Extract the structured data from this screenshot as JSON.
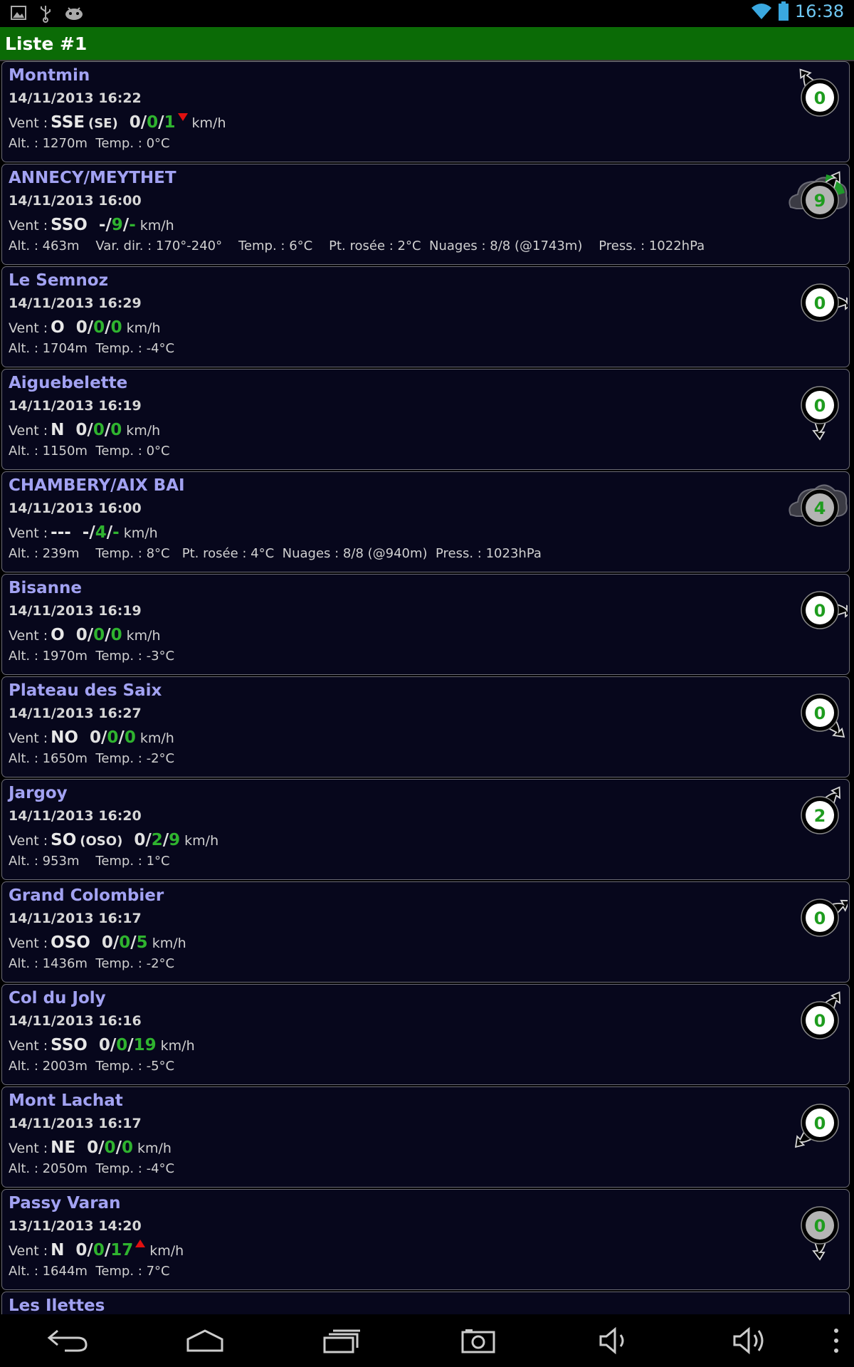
{
  "status_bar": {
    "time": "16:38",
    "left_icons": [
      "gallery-icon",
      "usb-icon",
      "android-debug-icon"
    ],
    "right_icons": [
      "wifi-icon",
      "battery-icon"
    ]
  },
  "title_bar": {
    "title": "Liste #1"
  },
  "colors": {
    "title_bar_bg": "#0b6b06",
    "station_name": "#a2a2f2",
    "wind_value_green": "#2fb32f",
    "trend_red": "#e01010",
    "card_bg": "#07071c"
  },
  "stations": [
    {
      "name": "Montmin",
      "date": "14/11/2013 16:22",
      "wind_label": "Vent :",
      "dir": "SSE",
      "dir2": "(SE)",
      "s1": "0",
      "s2": "0",
      "s3": "1",
      "trend": "down",
      "unit": "km/h",
      "details": "Alt. : 1270m  Temp. : 0°C",
      "badge": "0",
      "icon_type": "arrow",
      "arrow": "top-left",
      "ring": "white"
    },
    {
      "name": "ANNECY/MEYTHET",
      "date": "14/11/2013 16:00",
      "wind_label": "Vent :",
      "dir": "SSO",
      "dir2": "",
      "s1": "-",
      "s2": "9",
      "s3": "-",
      "trend": "",
      "unit": "km/h",
      "details": "Alt. : 463m    Var. dir. : 170°-240°    Temp. : 6°C    Pt. rosée : 2°C  Nuages : 8/8 (@1743m)    Press. : 1022hPa",
      "badge": "9",
      "icon_type": "cloud-arrow",
      "arrow": "top-right",
      "ring": "gray"
    },
    {
      "name": "Le Semnoz",
      "date": "14/11/2013 16:29",
      "wind_label": "Vent :",
      "dir": "O",
      "dir2": "",
      "s1": "0",
      "s2": "0",
      "s3": "0",
      "trend": "",
      "unit": "km/h",
      "details": "Alt. : 1704m  Temp. : -4°C",
      "badge": "0",
      "icon_type": "arrow",
      "arrow": "right",
      "ring": "white"
    },
    {
      "name": "Aiguebelette",
      "date": "14/11/2013 16:19",
      "wind_label": "Vent :",
      "dir": "N",
      "dir2": "",
      "s1": "0",
      "s2": "0",
      "s3": "0",
      "trend": "",
      "unit": "km/h",
      "details": "Alt. : 1150m  Temp. : 0°C",
      "badge": "0",
      "icon_type": "arrow",
      "arrow": "down",
      "ring": "white"
    },
    {
      "name": "CHAMBERY/AIX BAI",
      "date": "14/11/2013 16:00",
      "wind_label": "Vent :",
      "dir": "---",
      "dir2": "",
      "s1": "-",
      "s2": "4",
      "s3": "-",
      "trend": "",
      "unit": "km/h",
      "details": "Alt. : 239m    Temp. : 8°C   Pt. rosée : 4°C  Nuages : 8/8 (@940m)  Press. : 1023hPa",
      "badge": "4",
      "icon_type": "cloud",
      "arrow": "",
      "ring": "gray"
    },
    {
      "name": "Bisanne",
      "date": "14/11/2013 16:19",
      "wind_label": "Vent :",
      "dir": "O",
      "dir2": "",
      "s1": "0",
      "s2": "0",
      "s3": "0",
      "trend": "",
      "unit": "km/h",
      "details": "Alt. : 1970m  Temp. : -3°C",
      "badge": "0",
      "icon_type": "arrow",
      "arrow": "right",
      "ring": "white"
    },
    {
      "name": "Plateau des Saix",
      "date": "14/11/2013 16:27",
      "wind_label": "Vent :",
      "dir": "NO",
      "dir2": "",
      "s1": "0",
      "s2": "0",
      "s3": "0",
      "trend": "",
      "unit": "km/h",
      "details": "Alt. : 1650m  Temp. : -2°C",
      "badge": "0",
      "icon_type": "arrow",
      "arrow": "bottom-right",
      "ring": "white"
    },
    {
      "name": "Jargoy",
      "date": "14/11/2013 16:20",
      "wind_label": "Vent :",
      "dir": "SO",
      "dir2": "(OSO)",
      "s1": "0",
      "s2": "2",
      "s3": "9",
      "trend": "",
      "unit": "km/h",
      "details": "Alt. : 953m    Temp. : 1°C",
      "badge": "2",
      "icon_type": "arrow",
      "arrow": "top-right",
      "ring": "white"
    },
    {
      "name": "Grand Colombier",
      "date": "14/11/2013 16:17",
      "wind_label": "Vent :",
      "dir": "OSO",
      "dir2": "",
      "s1": "0",
      "s2": "0",
      "s3": "5",
      "trend": "",
      "unit": "km/h",
      "details": "Alt. : 1436m  Temp. : -2°C",
      "badge": "0",
      "icon_type": "arrow",
      "arrow": "upper-right",
      "ring": "white"
    },
    {
      "name": "Col du Joly",
      "date": "14/11/2013 16:16",
      "wind_label": "Vent :",
      "dir": "SSO",
      "dir2": "",
      "s1": "0",
      "s2": "0",
      "s3": "19",
      "trend": "",
      "unit": "km/h",
      "details": "Alt. : 2003m  Temp. : -5°C",
      "badge": "0",
      "icon_type": "arrow",
      "arrow": "top-right",
      "ring": "white"
    },
    {
      "name": "Mont Lachat",
      "date": "14/11/2013 16:17",
      "wind_label": "Vent :",
      "dir": "NE",
      "dir2": "",
      "s1": "0",
      "s2": "0",
      "s3": "0",
      "trend": "",
      "unit": "km/h",
      "details": "Alt. : 2050m  Temp. : -4°C",
      "badge": "0",
      "icon_type": "arrow",
      "arrow": "bottom-left",
      "ring": "white"
    },
    {
      "name": "Passy Varan",
      "date": "13/11/2013 14:20",
      "wind_label": "Vent :",
      "dir": "N",
      "dir2": "",
      "s1": "0",
      "s2": "0",
      "s3": "17",
      "trend": "up",
      "unit": "km/h",
      "details": "Alt. : 1644m  Temp. : 7°C",
      "badge": "0",
      "icon_type": "arrow",
      "arrow": "down",
      "ring": "gray"
    },
    {
      "name": "Les Ilettes",
      "date": "",
      "wind_label": "",
      "dir": "",
      "dir2": "",
      "s1": "",
      "s2": "",
      "s3": "",
      "trend": "",
      "unit": "",
      "details": "",
      "badge": "",
      "icon_type": "partial",
      "arrow": "",
      "ring": ""
    }
  ],
  "nav_bar": {
    "buttons": [
      "back-icon",
      "home-icon",
      "recent-apps-icon",
      "screenshot-icon",
      "volume-down-icon",
      "volume-up-icon",
      "menu-icon"
    ]
  }
}
